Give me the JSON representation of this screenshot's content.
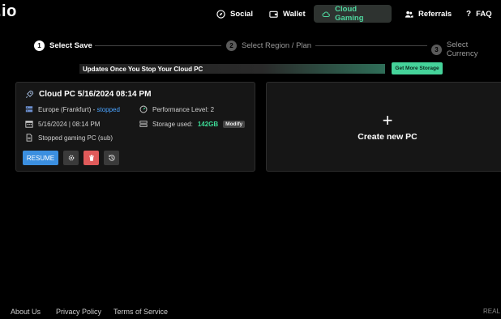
{
  "header": {
    "logo": ".io",
    "nav": [
      {
        "label": "Social",
        "icon": "compass-icon"
      },
      {
        "label": "Wallet",
        "icon": "wallet-icon"
      },
      {
        "label": "Cloud Gaming",
        "icon": "cloud-icon",
        "active": true
      },
      {
        "label": "Referrals",
        "icon": "users-icon"
      },
      {
        "label": "FAQ",
        "icon": "question-icon"
      }
    ]
  },
  "stepper": {
    "steps": [
      {
        "num": "1",
        "label": "Select Save",
        "active": true
      },
      {
        "num": "2",
        "label": "Select Region / Plan",
        "active": false
      },
      {
        "num": "3",
        "label": "Select Currency",
        "active": false
      }
    ]
  },
  "banner": {
    "text": "Updates Once You Stop Your Cloud PC",
    "button": "Get More Storage"
  },
  "pc_card": {
    "title": "Cloud PC 5/16/2024 08:14 PM",
    "region": "Europe (Frankfurt)",
    "status_sep": " - ",
    "status": "stopped",
    "performance": "Performance Level: 2",
    "date": "5/16/2024 | 08:14 PM",
    "storage_label": "Storage used:",
    "storage_value": "142GB",
    "modify": "Modify",
    "note": "Stopped gaming PC (sub)",
    "resume": "RESUME"
  },
  "create_card": {
    "plus": "+",
    "label": "Create new PC"
  },
  "footer": {
    "links": [
      "About Us",
      "Privacy Policy",
      "Terms of Service"
    ],
    "right": "REAL"
  },
  "colors": {
    "accent": "#45d39a",
    "link_blue": "#4aa3ff",
    "resume_blue": "#3b8fe0",
    "danger": "#e05a5a"
  }
}
